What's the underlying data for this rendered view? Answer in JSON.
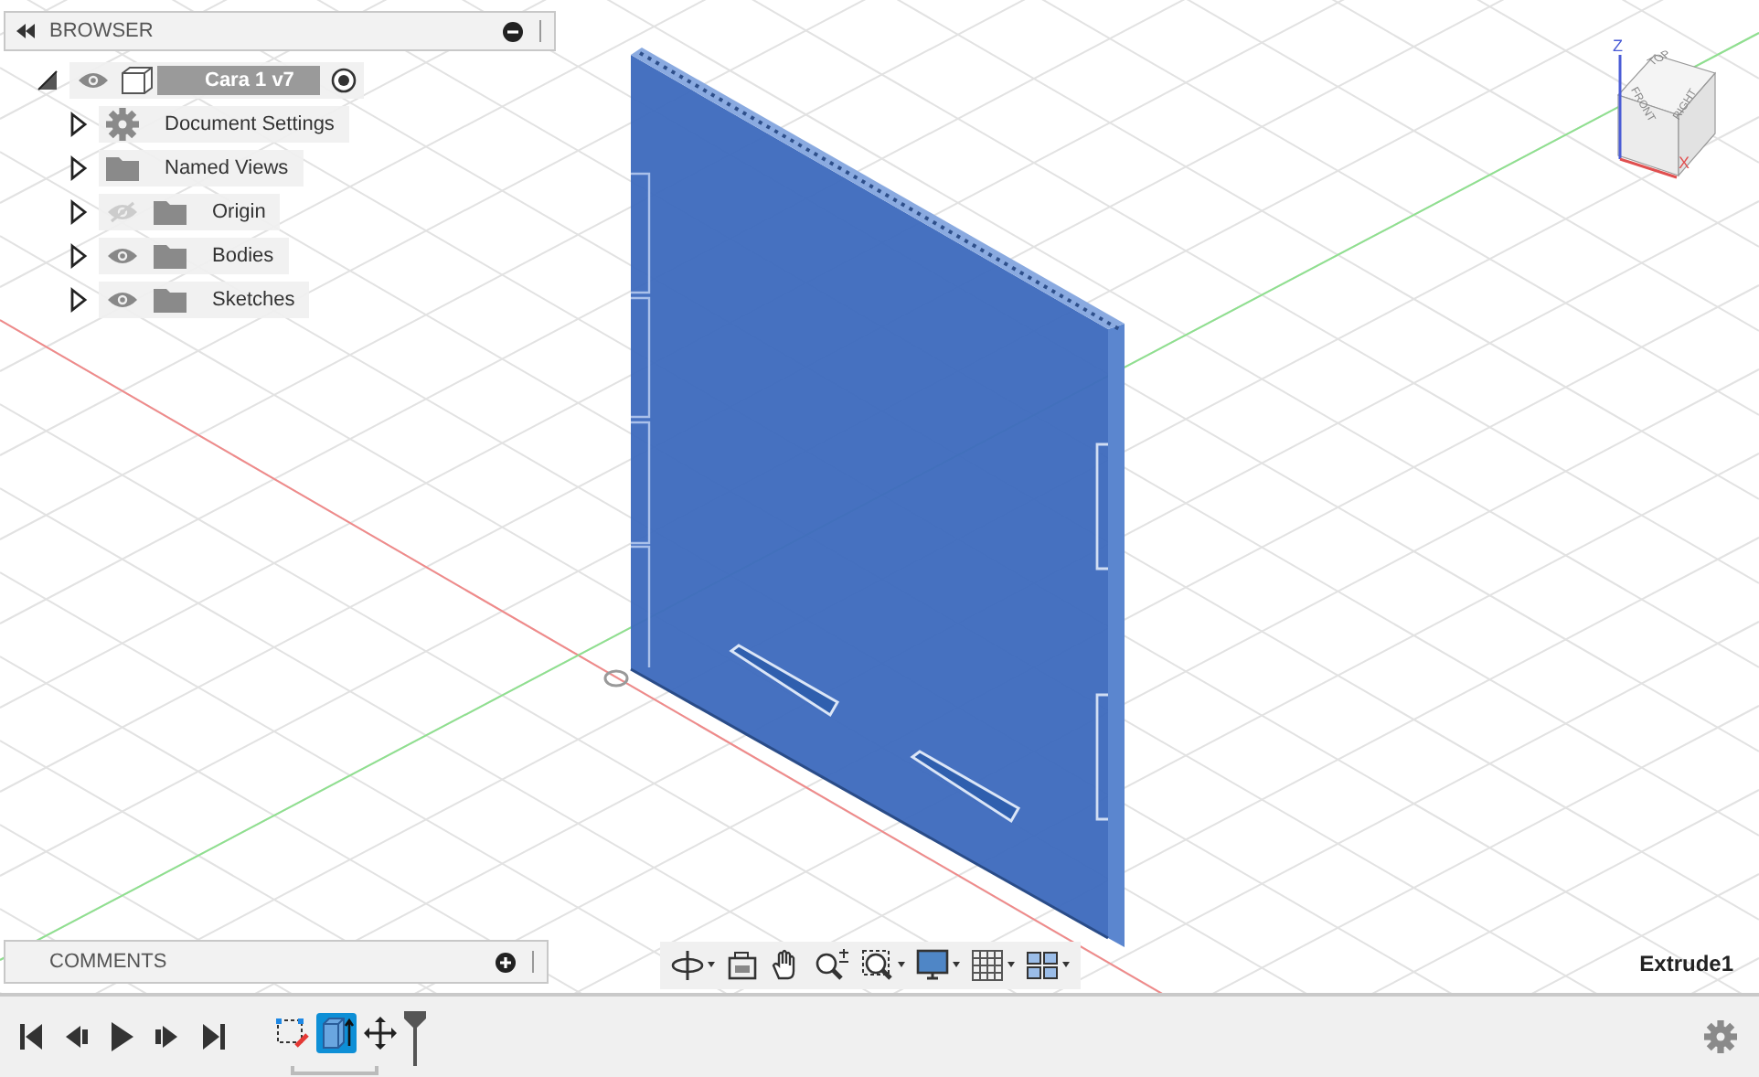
{
  "browser": {
    "title": "BROWSER",
    "root": {
      "label": "Cara 1 v7",
      "expanded": true,
      "visible": true,
      "children": [
        {
          "kind": "settings",
          "label": "Document Settings",
          "expanded": false
        },
        {
          "kind": "folder",
          "label": "Named Views",
          "expanded": false
        },
        {
          "kind": "folder",
          "label": "Origin",
          "expanded": false,
          "visible": false
        },
        {
          "kind": "folder",
          "label": "Bodies",
          "expanded": false,
          "visible": true
        },
        {
          "kind": "folder",
          "label": "Sketches",
          "expanded": false,
          "visible": true
        }
      ]
    }
  },
  "viewcube": {
    "faces": [
      {
        "kind": "top",
        "label": "TOP"
      },
      {
        "kind": "front",
        "label": "FRONT"
      },
      {
        "kind": "right",
        "label": "RIGHT"
      }
    ],
    "axes": [
      {
        "kind": "z",
        "label": "Z"
      },
      {
        "kind": "x",
        "label": "X"
      }
    ]
  },
  "comments": {
    "title": "COMMENTS"
  },
  "status": "Extrude1",
  "timeline": {
    "features": [
      {
        "kind": "sketch",
        "selected": false
      },
      {
        "kind": "extrude",
        "selected": true
      },
      {
        "kind": "move",
        "selected": false
      }
    ]
  }
}
